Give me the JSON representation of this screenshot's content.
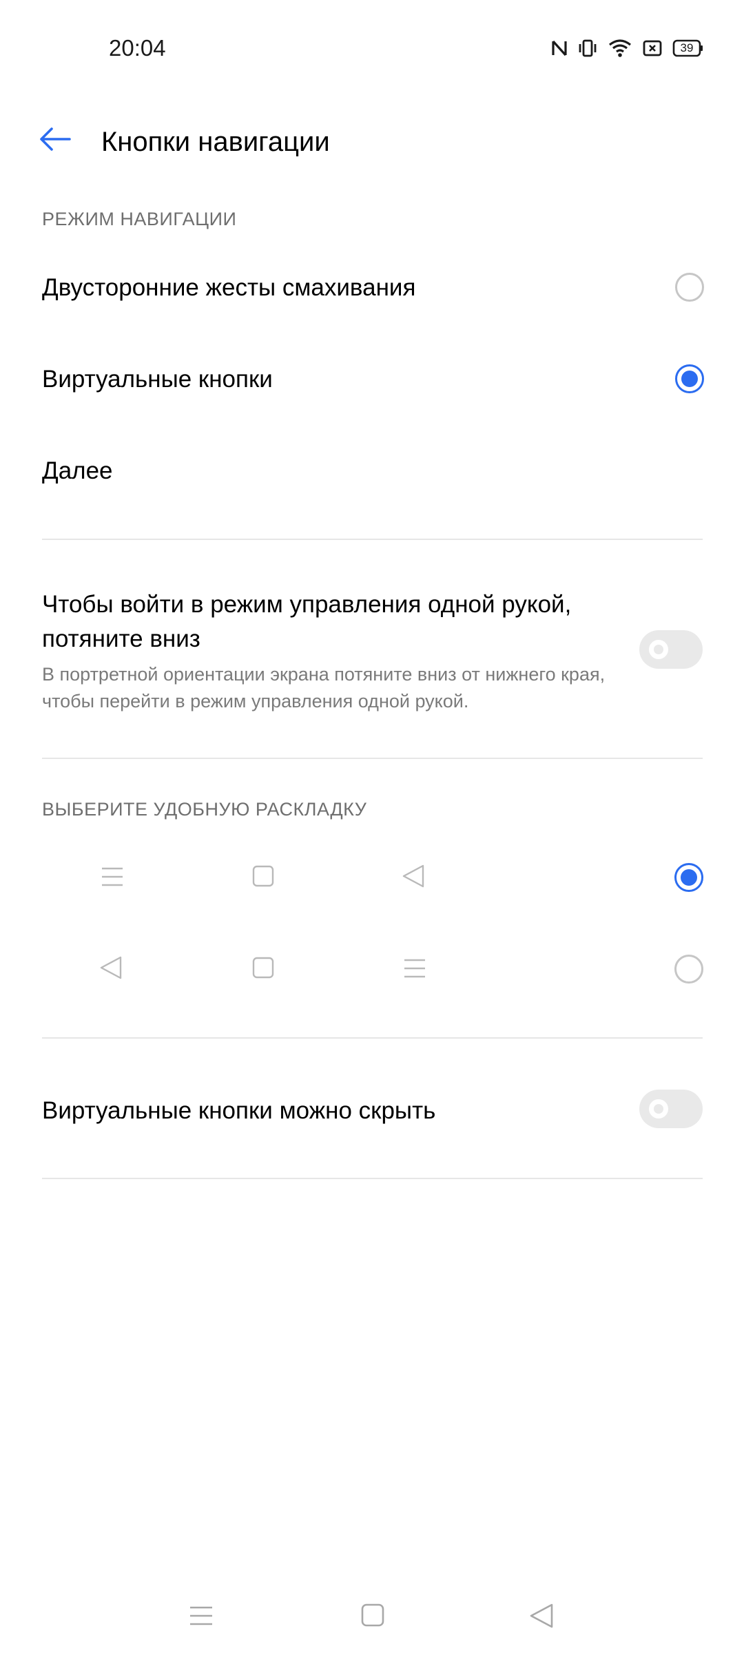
{
  "status_bar": {
    "time": "20:04",
    "battery": "39",
    "icons": [
      "nfc-icon",
      "vibrate-icon",
      "wifi-icon",
      "sim-icon",
      "battery-icon"
    ]
  },
  "header": {
    "title": "Кнопки навигации",
    "back_icon": "back-arrow-icon"
  },
  "navigation_mode": {
    "section_title": "РЕЖИМ НАВИГАЦИИ",
    "options": [
      {
        "label": "Двусторонние жесты смахивания",
        "selected": false
      },
      {
        "label": "Виртуальные кнопки",
        "selected": true
      }
    ],
    "more_label": "Далее"
  },
  "one_hand": {
    "title": "Чтобы войти в режим управления одной рукой, потяните вниз",
    "description": "В портретной ориентации экрана потяните вниз от нижнего края, чтобы перейти в режим управления одной рукой.",
    "enabled": false
  },
  "layout": {
    "section_title": "ВЫБЕРИТЕ УДОБНУЮ РАСКЛАДКУ",
    "options": [
      {
        "buttons": [
          "menu-icon",
          "home-square-icon",
          "back-triangle-icon"
        ],
        "selected": true
      },
      {
        "buttons": [
          "back-triangle-icon",
          "home-square-icon",
          "menu-icon"
        ],
        "selected": false
      }
    ]
  },
  "hide_buttons": {
    "label": "Виртуальные кнопки можно скрыть",
    "enabled": false
  },
  "nav_bar": {
    "buttons": [
      "menu-icon",
      "home-square-icon",
      "back-triangle-icon"
    ]
  },
  "colors": {
    "accent": "#2b6cf0",
    "secondary_text": "#6e6e6e",
    "divider": "#e6e6e6"
  }
}
